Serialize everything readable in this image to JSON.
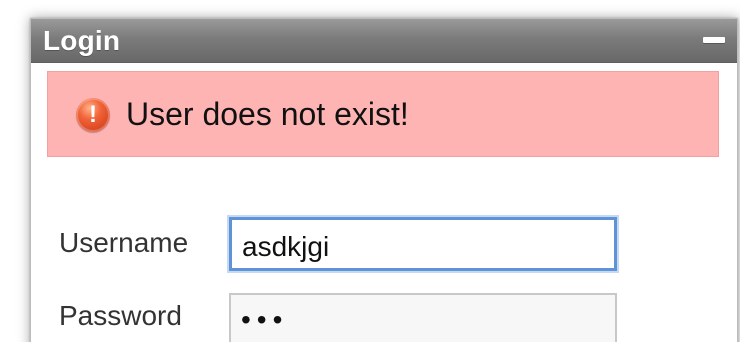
{
  "window": {
    "title": "Login"
  },
  "alert": {
    "message": "User does not exist!"
  },
  "form": {
    "username_label": "Username",
    "username_value": "asdkjgi",
    "password_label": "Password",
    "password_value": "•••"
  },
  "icons": {
    "minimize": "minimize-icon",
    "alert": "error-icon"
  },
  "colors": {
    "titlebar": "#7b7b7b",
    "alert_background": "#ffb4b4",
    "focus_border": "#5e93d8",
    "error_icon": "#e2522b"
  }
}
